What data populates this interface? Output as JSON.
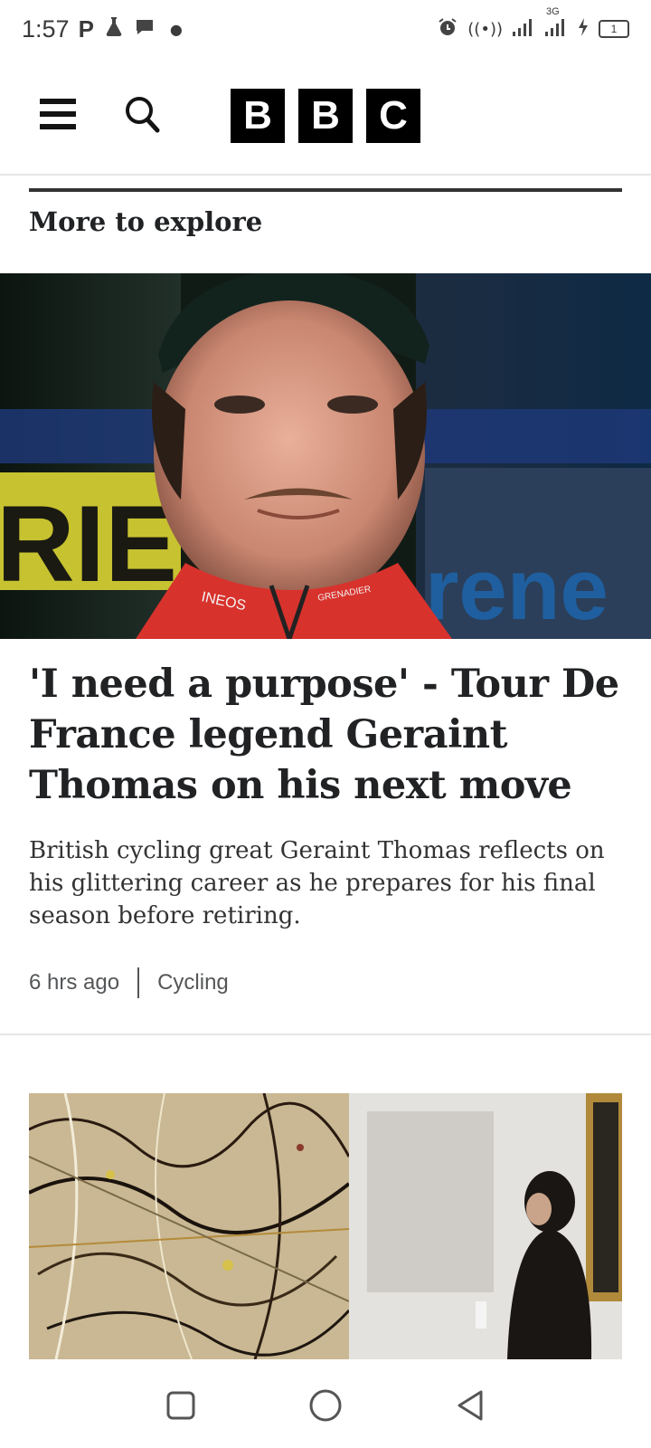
{
  "status_bar": {
    "time": "1:57",
    "notification_icons": [
      "parking-icon",
      "flask-icon",
      "chat-bubble-icon"
    ],
    "right_icons": [
      "alarm-icon",
      "hotspot-icon",
      "signal-icon",
      "signal-3g-icon",
      "charging-icon"
    ],
    "network_label": "3G",
    "battery_level": "1"
  },
  "header": {
    "logo_letters": [
      "B",
      "B",
      "C"
    ]
  },
  "section": {
    "title": "More to explore"
  },
  "hero_image": {
    "sign_text_left": "RIEN",
    "sign_text_right": "rene",
    "jersey_logo": "INEOS",
    "jersey_brand": "GRENADIER"
  },
  "article": {
    "headline": "'I need a purpose' - Tour De France legend Geraint Thomas on his next move",
    "summary": "British cycling great Geraint Thomas reflects on his glittering career as he prepares for his final season before retiring.",
    "time_ago": "6 hrs ago",
    "category": "Cycling"
  },
  "nav_bar": {
    "buttons": [
      "recent-apps-icon",
      "home-icon",
      "back-icon"
    ]
  },
  "colors": {
    "text": "#202224",
    "logo_bg": "#000000",
    "jersey_red": "#d8322c"
  }
}
